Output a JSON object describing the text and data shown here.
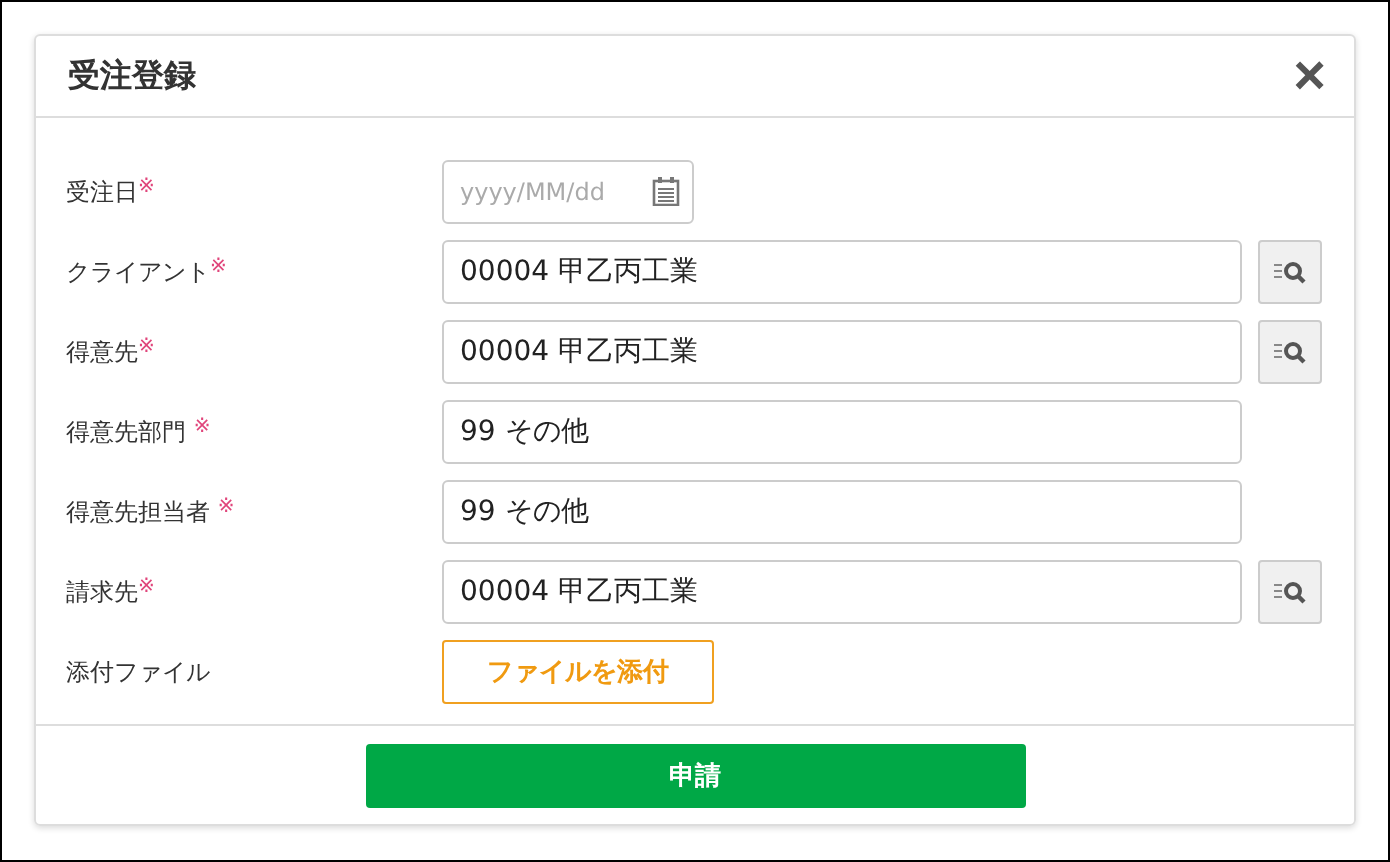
{
  "dialog": {
    "title": "受注登録",
    "close": "×"
  },
  "fields": [
    {
      "label": "受注日",
      "mark": "※",
      "kind": "date",
      "placeholder": "yyyy/MM/dd"
    },
    {
      "label": "クライアント",
      "mark": "※",
      "kind": "lookup",
      "value": "00004 甲乙丙工業"
    },
    {
      "label": "得意先",
      "mark": "※",
      "kind": "lookup",
      "value": "00004 甲乙丙工業"
    },
    {
      "label": "得意先部門 ",
      "mark": "※",
      "kind": "text",
      "value": "99 その他"
    },
    {
      "label": "得意先担当者 ",
      "mark": "※",
      "kind": "text",
      "value": "99 その他"
    },
    {
      "label": "請求先",
      "mark": "※",
      "kind": "lookup",
      "value": "00004 甲乙丙工業"
    },
    {
      "label": "添付ファイル",
      "kind": "file",
      "button": "ファイルを添付"
    }
  ],
  "submit": "申請"
}
